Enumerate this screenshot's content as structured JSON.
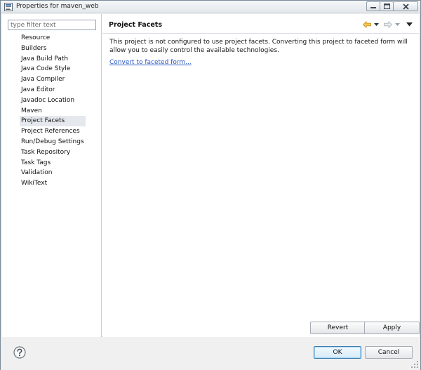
{
  "window": {
    "title": "Properties for maven_web"
  },
  "sidebar": {
    "filter_placeholder": "type filter text",
    "items": [
      {
        "label": "Resource"
      },
      {
        "label": "Builders"
      },
      {
        "label": "Java Build Path"
      },
      {
        "label": "Java Code Style"
      },
      {
        "label": "Java Compiler"
      },
      {
        "label": "Java Editor"
      },
      {
        "label": "Javadoc Location"
      },
      {
        "label": "Maven"
      },
      {
        "label": "Project Facets",
        "selected": true
      },
      {
        "label": "Project References"
      },
      {
        "label": "Run/Debug Settings"
      },
      {
        "label": "Task Repository"
      },
      {
        "label": "Task Tags"
      },
      {
        "label": "Validation"
      },
      {
        "label": "WikiText"
      }
    ]
  },
  "main": {
    "title": "Project Facets",
    "description": "This project is not configured to use project facets. Converting this project to faceted form will allow you to easily control the available technologies.",
    "convert_link": "Convert to faceted form...",
    "revert_label": "Revert",
    "apply_label": "Apply"
  },
  "footer": {
    "ok_label": "OK",
    "cancel_label": "Cancel"
  },
  "icons": {
    "title": "eclipse-properties-icon",
    "back": "back-arrow-icon",
    "forward": "forward-arrow-icon",
    "menu": "view-menu-icon",
    "help": "help-icon"
  },
  "colors": {
    "link": "#2a59c4",
    "back_arrow": "#e0a21e",
    "selection": "#e5e9ee"
  }
}
